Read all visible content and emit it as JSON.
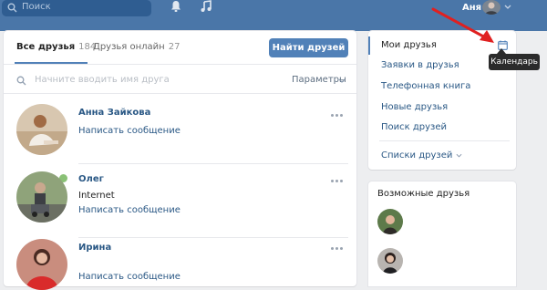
{
  "topbar": {
    "search_placeholder": "Поиск",
    "username": "Аня",
    "icons": [
      "search-icon",
      "bell-icon",
      "music-icon",
      "chevron-down-icon"
    ]
  },
  "friends": {
    "tabs": [
      {
        "label": "Все друзья",
        "count": "184"
      },
      {
        "label": "Друзья онлайн",
        "count": "27"
      }
    ],
    "find_button": "Найти друзей",
    "search_placeholder": "Начните вводить имя друга",
    "params_label": "Параметры",
    "list": [
      {
        "name": "Анна Зайкова",
        "sub": "",
        "action": "Написать сообщение",
        "online": true
      },
      {
        "name": "Олег",
        "sub": "Internet",
        "action": "Написать сообщение",
        "online": false
      },
      {
        "name": "Ирина",
        "sub": "",
        "action": "Написать сообщение",
        "online": false
      }
    ]
  },
  "menu": {
    "items": [
      "Мои друзья",
      "Заявки в друзья",
      "Телефонная книга",
      "Новые друзья",
      "Поиск друзей"
    ],
    "lists_label": "Списки друзей",
    "tooltip": "Календарь"
  },
  "possible_friends": {
    "title": "Возможные друзья"
  },
  "colors": {
    "topbar": "#4a76a8",
    "accent": "#5181b8",
    "link": "#2a5885",
    "background": "#edeef0",
    "annotation_arrow": "#e02020"
  }
}
